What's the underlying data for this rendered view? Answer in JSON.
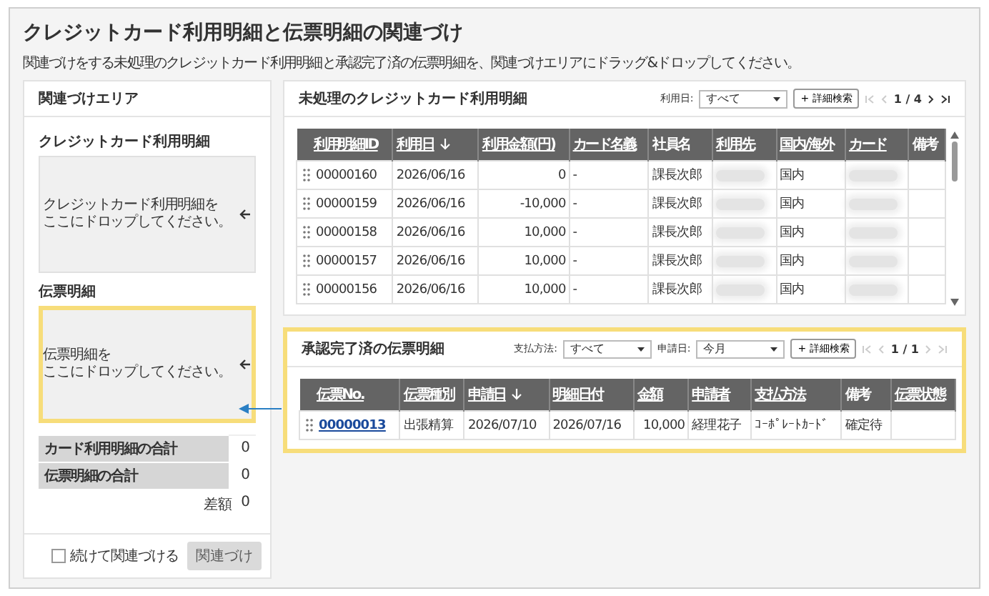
{
  "title": "クレジットカード利用明細と伝票明細の関連づけ",
  "subtitle": "関連づけをする未処理のクレジットカード利用明細と承認完了済の伝票明細を、関連づけエリアにドラッグ&ドロップしてください。",
  "link_area": {
    "title": "関連づけエリア",
    "zones": [
      {
        "label": "クレジットカード利用明細",
        "hint_1": "クレジットカード利用明細を",
        "hint_2": "ここにドロップしてください。",
        "highlighted": false
      },
      {
        "label": "伝票明細",
        "hint_1": "伝票明細を",
        "hint_2": "ここにドロップしてください。",
        "highlighted": true
      }
    ],
    "totals": [
      {
        "label": "カード利用明細の合計",
        "value": "0"
      },
      {
        "label": "伝票明細の合計",
        "value": "0"
      }
    ],
    "difference": {
      "label": "差額",
      "value": "0"
    },
    "continue_checkbox": {
      "label": "続けて関連づける",
      "checked": false
    },
    "link_button": {
      "label": "関連づけ",
      "disabled": true
    }
  },
  "panels": [
    {
      "title": "未処理のクレジットカード利用明細",
      "highlighted": false,
      "scroll": true,
      "filters": [
        {
          "label": "利用日:",
          "value": "すべて"
        }
      ],
      "search_button": "+ 詳細検索",
      "page": "1 / 4",
      "at_first": true,
      "at_last": false,
      "columns": [
        {
          "label": "利用明細ID",
          "sortable": true,
          "sorted": false,
          "kind": "id"
        },
        {
          "label": "利用日",
          "sortable": true,
          "sorted": true,
          "kind": "text"
        },
        {
          "label": "利用金額(円)",
          "sortable": true,
          "sorted": false,
          "kind": "number"
        },
        {
          "label": "カード名義",
          "sortable": true,
          "sorted": false,
          "kind": "text"
        },
        {
          "label": "社員名",
          "sortable": false,
          "sorted": false,
          "kind": "text"
        },
        {
          "label": "利用先",
          "sortable": true,
          "sorted": false,
          "kind": "redacted"
        },
        {
          "label": "国内/海外",
          "sortable": true,
          "sorted": false,
          "kind": "text"
        },
        {
          "label": "カード",
          "sortable": true,
          "sorted": false,
          "kind": "redacted"
        },
        {
          "label": "備考",
          "sortable": false,
          "sorted": false,
          "kind": "text"
        }
      ],
      "rows": [
        [
          "00000160",
          "2026/06/16",
          "0",
          "-",
          "課長次郎",
          "国内"
        ],
        [
          "00000159",
          "2026/06/16",
          "-10,000",
          "-",
          "課長次郎",
          "国内"
        ],
        [
          "00000158",
          "2026/06/16",
          "10,000",
          "-",
          "課長次郎",
          "国内"
        ],
        [
          "00000157",
          "2026/06/16",
          "10,000",
          "-",
          "課長次郎",
          "国内"
        ],
        [
          "00000156",
          "2026/06/16",
          "10,000",
          "-",
          "課長次郎",
          "国内"
        ]
      ]
    },
    {
      "title": "承認完了済の伝票明細",
      "highlighted": true,
      "scroll": false,
      "filters": [
        {
          "label": "支払方法:",
          "value": "すべて"
        },
        {
          "label": "申請日:",
          "value": "今月"
        }
      ],
      "search_button": "+ 詳細検索",
      "page": "1 / 1",
      "at_first": true,
      "at_last": true,
      "columns": [
        {
          "label": "伝票No.",
          "sortable": true,
          "sorted": false,
          "kind": "link"
        },
        {
          "label": "伝票種別",
          "sortable": true,
          "sorted": false,
          "kind": "text"
        },
        {
          "label": "申請日",
          "sortable": true,
          "sorted": true,
          "kind": "text"
        },
        {
          "label": "明細日付",
          "sortable": true,
          "sorted": false,
          "kind": "text"
        },
        {
          "label": "金額",
          "sortable": true,
          "sorted": false,
          "kind": "number"
        },
        {
          "label": "申請者",
          "sortable": true,
          "sorted": false,
          "kind": "text"
        },
        {
          "label": "支払方法",
          "sortable": true,
          "sorted": false,
          "kind": "text"
        },
        {
          "label": "備考",
          "sortable": false,
          "sorted": false,
          "kind": "text"
        },
        {
          "label": "伝票状態",
          "sortable": true,
          "sorted": false,
          "kind": "text"
        }
      ],
      "rows": [
        [
          "00000013",
          "出張精算",
          "2026/07/10",
          "2026/07/16",
          "10,000",
          "経理花子",
          "ｺｰﾎﾟﾚｰﾄｶｰﾄﾞ",
          "確定待"
        ]
      ]
    }
  ]
}
